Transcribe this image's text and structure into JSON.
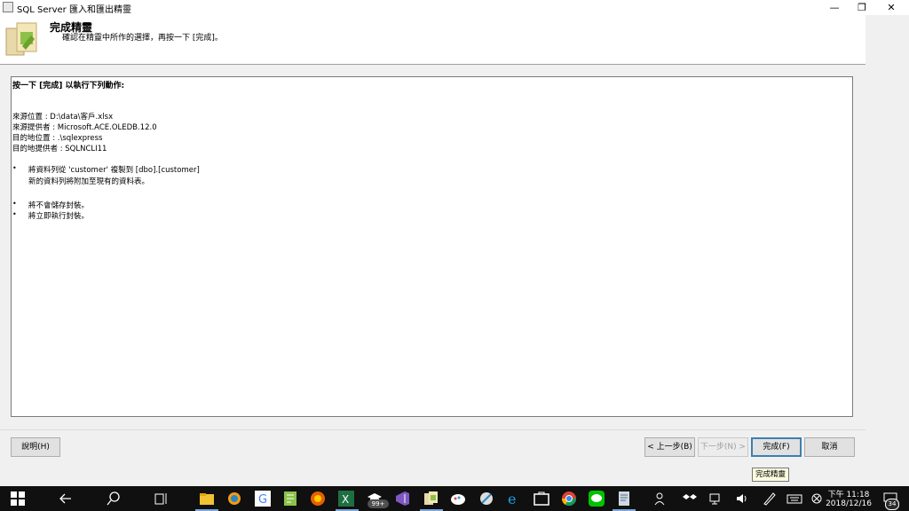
{
  "window": {
    "title": "SQL Server 匯入和匯出精靈",
    "minimize_glyph": "—",
    "restore_glyph": "❐",
    "close_glyph": "✕"
  },
  "header": {
    "title": "完成精靈",
    "subtitle": "確認在精靈中所作的選擇，再按一下 [完成]。"
  },
  "summary": {
    "heading": "按一下 [完成] 以執行下列動作:",
    "source_location": "來源位置 : D:\\data\\客戶.xlsx",
    "source_provider": "來源提供者 : Microsoft.ACE.OLEDB.12.0",
    "dest_location": "目的地位置 : .\\sqlexpress",
    "dest_provider": "目的地提供者 : SQLNCLI11",
    "bullets": [
      {
        "mark": "•",
        "line1": "將資料列從 'customer' 複製到 [dbo].[customer]",
        "line2": "新的資料列將附加至現有的資料表。"
      },
      {
        "mark": "•",
        "line1": "將不會儲存封裝。",
        "line2": ""
      },
      {
        "mark": "•",
        "line1": "將立即執行封裝。",
        "line2": ""
      }
    ]
  },
  "buttons": {
    "help": "說明(H)",
    "back": "< 上一步(B)",
    "next": "下一步(N) >",
    "finish": "完成(F)",
    "cancel": "取消"
  },
  "tooltip": "完成精靈",
  "taskbar": {
    "badge_count": "99+",
    "time": "下午 11:18",
    "date": "2018/12/16",
    "notification_count": "34"
  }
}
